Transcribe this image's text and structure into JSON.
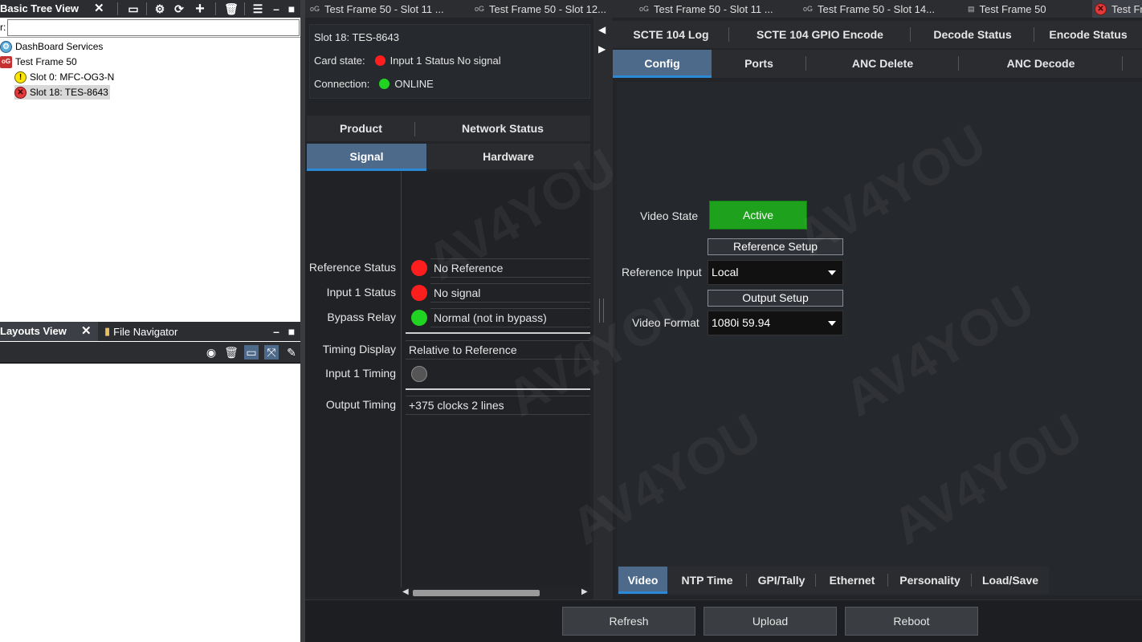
{
  "left": {
    "tree_title": "Basic Tree View",
    "close": "✕",
    "filter_label": "r:",
    "filter_value": "",
    "tree": [
      {
        "label": "DashBoard Services",
        "icon": "services-icon"
      },
      {
        "label": "Test Frame 50",
        "icon": "frame-icon"
      },
      {
        "label": "Slot 0: MFC-OG3-N",
        "icon": "warning-icon"
      },
      {
        "label": "Slot 18: TES-8643",
        "icon": "error-icon"
      }
    ],
    "layouts_title": "Layouts View",
    "file_nav_title": "File Navigator"
  },
  "doc_tabs": [
    {
      "label": "Test Frame 50 - Slot 11 ..."
    },
    {
      "label": "Test Frame 50 - Slot 12..."
    },
    {
      "label": "Test Frame 50 - Slot 11 ..."
    },
    {
      "label": "Test Frame 50 - Slot 14..."
    },
    {
      "label": "Test Frame 50"
    },
    {
      "label": "Test Fr"
    }
  ],
  "status": {
    "slot": "Slot 18: TES-8643",
    "card_state_label": "Card state:",
    "card_state_value": "Input 1 Status No signal",
    "connection_label": "Connection:",
    "connection_value": "ONLINE"
  },
  "mid_tabs": {
    "row1": [
      "Product",
      "Network Status"
    ],
    "row2": [
      "Signal",
      "Hardware"
    ]
  },
  "signal": {
    "reference_status_label": "Reference Status",
    "reference_status_value": "No Reference",
    "input1_status_label": "Input 1 Status",
    "input1_status_value": "No signal",
    "bypass_relay_label": "Bypass Relay",
    "bypass_relay_value": "Normal (not in bypass)",
    "timing_display_label": "Timing Display",
    "timing_display_value": "Relative to Reference",
    "input1_timing_label": "Input 1 Timing",
    "output_timing_label": "Output Timing",
    "output_timing_value": "+375 clocks 2 lines"
  },
  "right_tabs": {
    "row1": [
      "SCTE 104 Log",
      "SCTE 104 GPIO Encode",
      "Decode Status",
      "Encode Status"
    ],
    "row2": [
      "Config",
      "Ports",
      "ANC Delete",
      "ANC Decode"
    ]
  },
  "config": {
    "video_state_label": "Video State",
    "video_state_value": "Active",
    "reference_setup": "Reference Setup",
    "reference_input_label": "Reference Input",
    "reference_input_value": "Local",
    "output_setup": "Output Setup",
    "video_format_label": "Video Format",
    "video_format_value": "1080i 59.94"
  },
  "bottom_tabs": [
    "Video",
    "NTP Time",
    "GPI/Tally",
    "Ethernet",
    "Personality",
    "Load/Save"
  ],
  "actions": {
    "refresh": "Refresh",
    "upload": "Upload",
    "reboot": "Reboot"
  },
  "watermark": "AV4YOU"
}
